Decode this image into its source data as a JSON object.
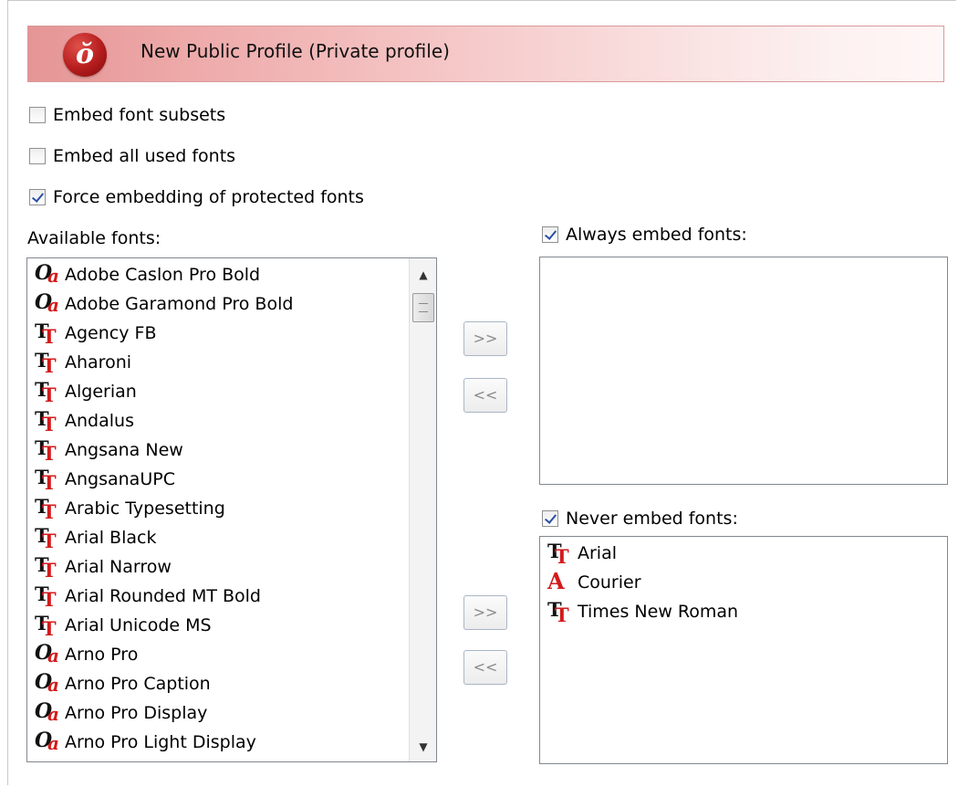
{
  "header": {
    "title": "New Public Profile (Private profile)",
    "logo_icon": "profile-logo-icon",
    "gradient_colors": [
      "#e59595",
      "#fdf1f1"
    ]
  },
  "options": [
    {
      "label": "Embed font subsets",
      "checked": false
    },
    {
      "label": "Embed all used fonts",
      "checked": false
    },
    {
      "label": "Force embedding of protected fonts",
      "checked": true
    }
  ],
  "available": {
    "label": "Available fonts:",
    "fonts": [
      {
        "name": "Adobe Caslon Pro Bold",
        "icon": "opentype-font-icon"
      },
      {
        "name": "Adobe Garamond Pro Bold",
        "icon": "opentype-font-icon"
      },
      {
        "name": "Agency FB",
        "icon": "truetype-font-icon"
      },
      {
        "name": "Aharoni",
        "icon": "truetype-font-icon"
      },
      {
        "name": "Algerian",
        "icon": "truetype-font-icon"
      },
      {
        "name": "Andalus",
        "icon": "truetype-font-icon"
      },
      {
        "name": "Angsana New",
        "icon": "truetype-font-icon"
      },
      {
        "name": "AngsanaUPC",
        "icon": "truetype-font-icon"
      },
      {
        "name": "Arabic Typesetting",
        "icon": "truetype-font-icon"
      },
      {
        "name": "Arial Black",
        "icon": "truetype-font-icon"
      },
      {
        "name": "Arial Narrow",
        "icon": "truetype-font-icon"
      },
      {
        "name": "Arial Rounded MT Bold",
        "icon": "truetype-font-icon"
      },
      {
        "name": "Arial Unicode MS",
        "icon": "truetype-font-icon"
      },
      {
        "name": "Arno Pro",
        "icon": "opentype-font-icon"
      },
      {
        "name": "Arno Pro Caption",
        "icon": "opentype-font-icon"
      },
      {
        "name": "Arno Pro Display",
        "icon": "opentype-font-icon"
      },
      {
        "name": "Arno Pro Light Display",
        "icon": "opentype-font-icon"
      }
    ]
  },
  "always": {
    "label": "Always embed fonts:",
    "checked": true,
    "fonts": []
  },
  "never": {
    "label": "Never embed fonts:",
    "checked": true,
    "fonts": [
      {
        "name": "Arial",
        "icon": "truetype-font-icon"
      },
      {
        "name": "Courier",
        "icon": "postscript-font-icon"
      },
      {
        "name": "Times New Roman",
        "icon": "truetype-font-icon"
      }
    ]
  },
  "buttons": {
    "add": ">>",
    "remove": "<<"
  }
}
